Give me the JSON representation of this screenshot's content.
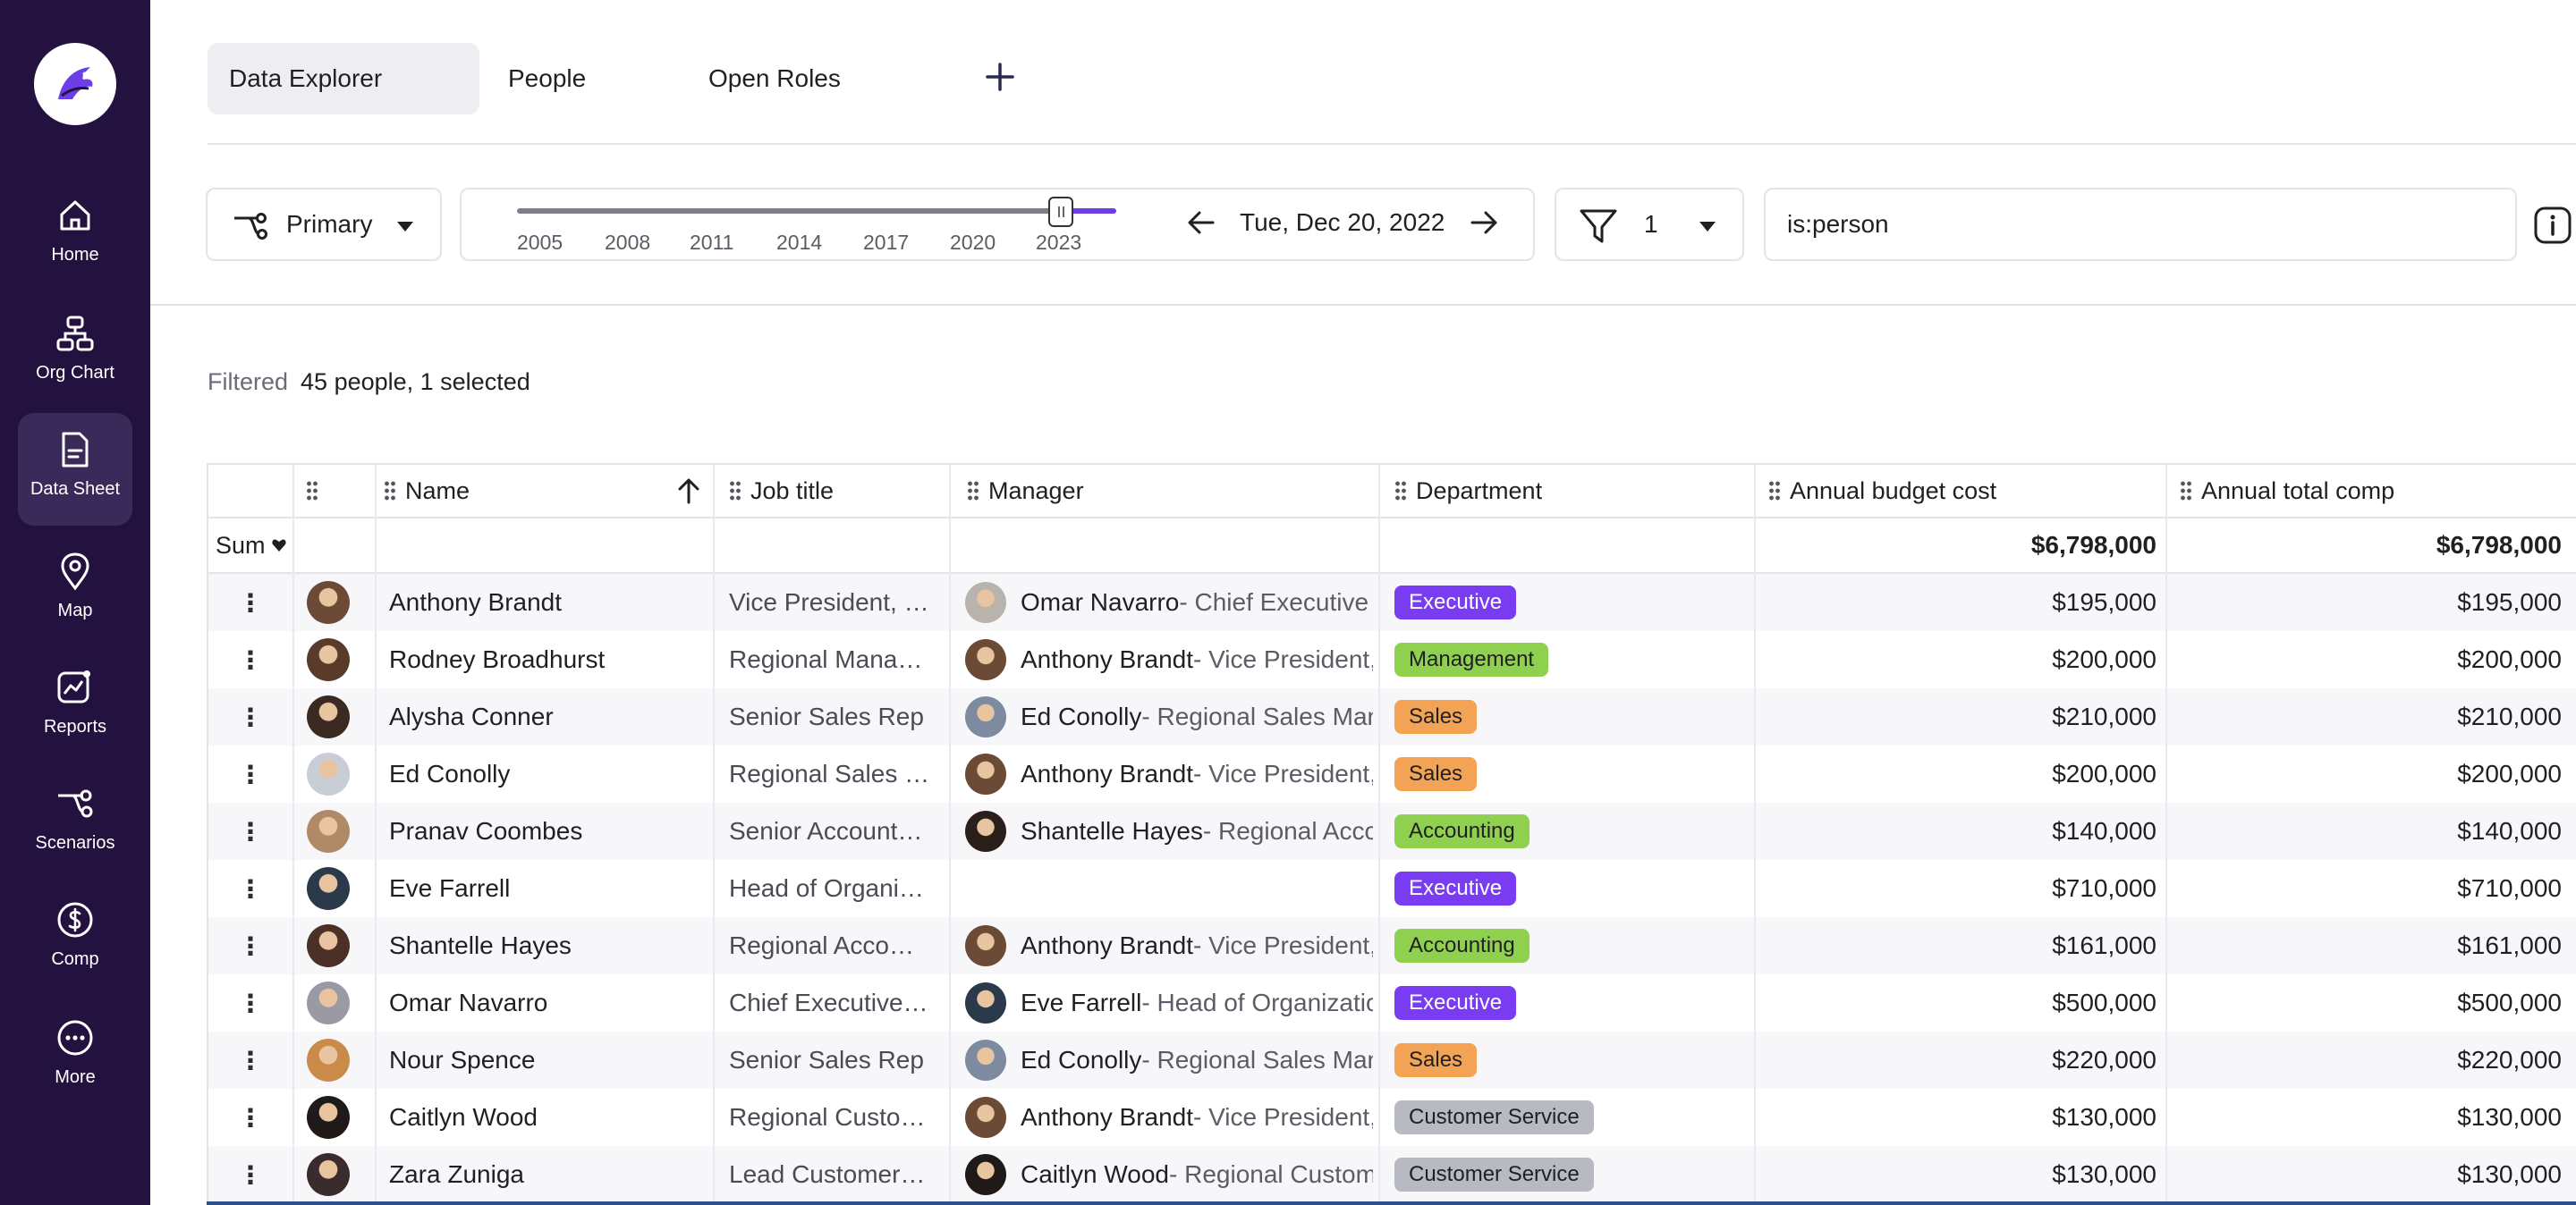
{
  "sidebar": {
    "items": [
      {
        "label": "Home",
        "icon": "home-icon"
      },
      {
        "label": "Org Chart",
        "icon": "org-chart-icon"
      },
      {
        "label": "Data Sheet",
        "icon": "data-sheet-icon",
        "active": true
      },
      {
        "label": "Map",
        "icon": "map-pin-icon"
      },
      {
        "label": "Reports",
        "icon": "reports-icon"
      },
      {
        "label": "Scenarios",
        "icon": "scenarios-icon"
      },
      {
        "label": "Comp",
        "icon": "dollar-icon"
      },
      {
        "label": "More",
        "icon": "more-icon"
      }
    ]
  },
  "tabs": [
    {
      "label": "Data Explorer",
      "active": true
    },
    {
      "label": "People"
    },
    {
      "label": "Open Roles"
    }
  ],
  "toolbar": {
    "scenario_label": "Primary",
    "timeline_years": [
      "2005",
      "2008",
      "2011",
      "2014",
      "2017",
      "2020",
      "2023"
    ],
    "date": "Tue, Dec 20, 2022",
    "filter_count": "1",
    "query": "is:person"
  },
  "filtered": {
    "label": "Filtered",
    "value": "45 people, 1 selected"
  },
  "table": {
    "columns": [
      "Name",
      "Job title",
      "Manager",
      "Department",
      "Annual budget cost",
      "Annual total comp"
    ],
    "sum_label": "Sum",
    "sum_budget": "$6,798,000",
    "sum_comp": "$6,798,000",
    "rows": [
      {
        "name": "Anthony Brandt",
        "job": "Vice President, …",
        "mgr_name": "Omar Navarro",
        "mgr_title": " - Chief Executive Of",
        "dept": "Executive",
        "budget": "$195,000",
        "comp": "$195,000"
      },
      {
        "name": "Rodney Broadhurst",
        "job": "Regional Mana…",
        "mgr_name": "Anthony Brandt",
        "mgr_title": " - Vice President, Ne",
        "dept": "Management",
        "budget": "$200,000",
        "comp": "$200,000"
      },
      {
        "name": "Alysha Conner",
        "job": "Senior Sales Rep",
        "mgr_name": "Ed Conolly",
        "mgr_title": " - Regional Sales Manag",
        "dept": "Sales",
        "budget": "$210,000",
        "comp": "$210,000"
      },
      {
        "name": "Ed Conolly",
        "job": "Regional Sales …",
        "mgr_name": "Anthony Brandt",
        "mgr_title": " - Vice President, Ne",
        "dept": "Sales",
        "budget": "$200,000",
        "comp": "$200,000"
      },
      {
        "name": "Pranav Coombes",
        "job": "Senior Account…",
        "mgr_name": "Shantelle Hayes",
        "mgr_title": " - Regional Accoun",
        "dept": "Accounting",
        "budget": "$140,000",
        "comp": "$140,000"
      },
      {
        "name": "Eve Farrell",
        "job": "Head of Organi…",
        "mgr_name": "",
        "mgr_title": "",
        "dept": "Executive",
        "budget": "$710,000",
        "comp": "$710,000"
      },
      {
        "name": "Shantelle Hayes",
        "job": "Regional Acco…",
        "mgr_name": "Anthony Brandt",
        "mgr_title": " - Vice President, Ne",
        "dept": "Accounting",
        "budget": "$161,000",
        "comp": "$161,000"
      },
      {
        "name": "Omar Navarro",
        "job": "Chief Executive…",
        "mgr_name": "Eve Farrell",
        "mgr_title": " - Head of Organization",
        "dept": "Executive",
        "budget": "$500,000",
        "comp": "$500,000"
      },
      {
        "name": "Nour Spence",
        "job": "Senior Sales Rep",
        "mgr_name": "Ed Conolly",
        "mgr_title": " - Regional Sales Manag",
        "dept": "Sales",
        "budget": "$220,000",
        "comp": "$220,000"
      },
      {
        "name": "Caitlyn Wood",
        "job": "Regional Custo…",
        "mgr_name": "Anthony Brandt",
        "mgr_title": " - Vice President, Ne",
        "dept": "Customer Service",
        "budget": "$130,000",
        "comp": "$130,000"
      },
      {
        "name": "Zara Zuniga",
        "job": "Lead Customer…",
        "mgr_name": "Caitlyn Wood",
        "mgr_title": " - Regional Customer",
        "dept": "Customer Service",
        "budget": "$130,000",
        "comp": "$130,000"
      }
    ]
  },
  "colors": {
    "sidebar_bg": "#23123f",
    "accent": "#6d3ee8",
    "executive": "#7a3cf0",
    "management": "#8fd14f",
    "sales": "#f2a454",
    "accounting": "#8fd14f",
    "customer_service": "#b7bac3"
  }
}
